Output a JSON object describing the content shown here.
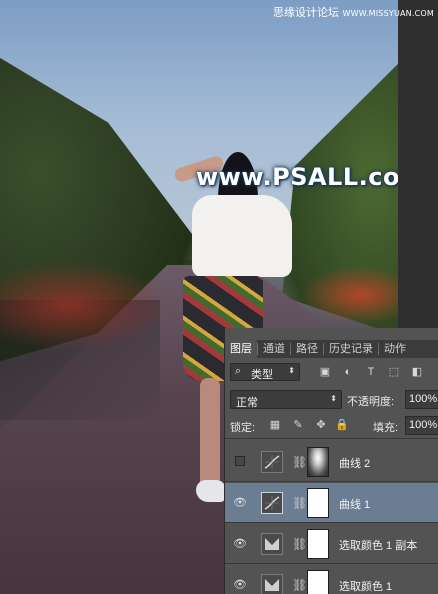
{
  "watermark": {
    "main": "www.PSALL.com",
    "site_cn": "思缘设计论坛",
    "site_url": "WWW.MISSYUAN.COM"
  },
  "panel": {
    "tabs": [
      {
        "label": "图层",
        "active": true
      },
      {
        "label": "通道",
        "active": false
      },
      {
        "label": "路径",
        "active": false
      },
      {
        "label": "历史记录",
        "active": false
      },
      {
        "label": "动作",
        "active": false
      }
    ],
    "filter_label": "类型",
    "filter_icons": [
      "image-filter-icon",
      "adjustment-filter-icon",
      "type-filter-icon",
      "shape-filter-icon",
      "smart-object-filter-icon"
    ],
    "blend_mode": "正常",
    "opacity_label": "不透明度:",
    "opacity_value": "100%",
    "lock_label": "锁定:",
    "lock_icons": [
      "lock-transparent-icon",
      "lock-image-icon",
      "lock-position-icon",
      "lock-all-icon"
    ],
    "fill_label": "填充:",
    "fill_value": "100%",
    "layers": [
      {
        "name": "曲线 2",
        "visible": false,
        "type": "curves",
        "mask": "dark",
        "selected": false
      },
      {
        "name": "曲线 1",
        "visible": true,
        "type": "curves",
        "mask": "white",
        "selected": true
      },
      {
        "name": "选取颜色 1 副本",
        "visible": true,
        "type": "selective-color",
        "mask": "white",
        "selected": false
      },
      {
        "name": "选取颜色 1",
        "visible": true,
        "type": "selective-color",
        "mask": "white",
        "selected": false
      }
    ]
  },
  "colors": {
    "panel_bg": "#535353",
    "selected_layer": "#6a7d93",
    "watermark_glow": "#1b3a5c"
  }
}
